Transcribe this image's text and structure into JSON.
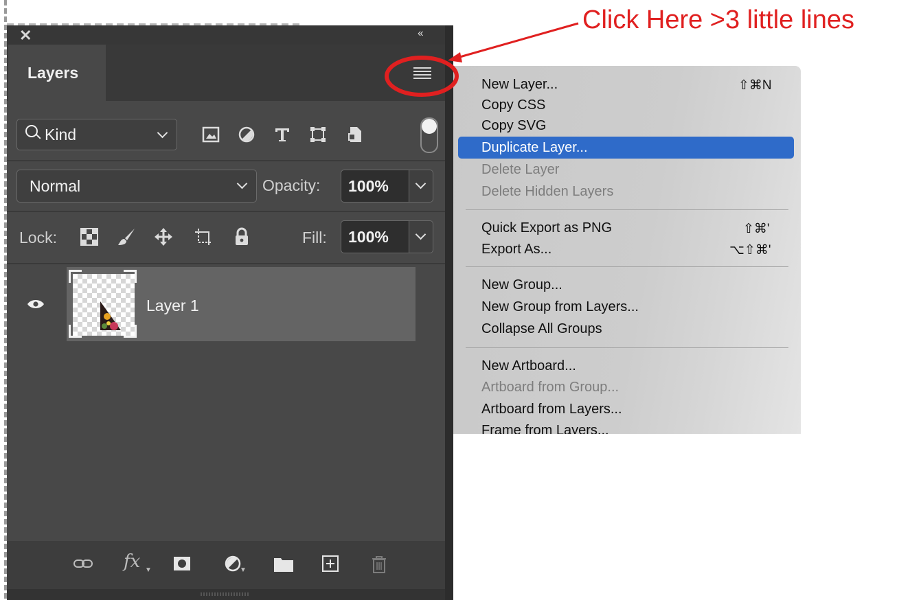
{
  "annotation": {
    "text": "Click Here >3 little lines",
    "color": "#e02020"
  },
  "panel": {
    "tab_label": "Layers",
    "kind_filter": "Kind",
    "filter_icons": [
      "image-filter-icon",
      "adjustment-filter-icon",
      "type-filter-icon",
      "shape-filter-icon",
      "smart-object-filter-icon"
    ],
    "blend_mode": "Normal",
    "opacity_label": "Opacity:",
    "opacity_value": "100%",
    "lock_label": "Lock:",
    "lock_icons": [
      "lock-transparent-pixels-icon",
      "lock-image-pixels-icon",
      "lock-position-icon",
      "lock-artboard-icon",
      "lock-all-icon"
    ],
    "fill_label": "Fill:",
    "fill_value": "100%",
    "layers": [
      {
        "name": "Layer 1",
        "visible": true
      }
    ],
    "footer_icons": [
      "link-layers-icon",
      "fx-icon",
      "layer-mask-icon",
      "adjustment-layer-icon",
      "group-folder-icon",
      "new-layer-icon",
      "trash-icon"
    ],
    "fx_text": "fx"
  },
  "menu": {
    "selected_color": "#2f6bc9",
    "items": [
      {
        "label": "New Layer...",
        "shortcut": "⇧⌘N",
        "state": "enabled"
      },
      {
        "label": "Copy CSS",
        "shortcut": "",
        "state": "enabled"
      },
      {
        "label": "Copy SVG",
        "shortcut": "",
        "state": "enabled"
      },
      {
        "label": "Duplicate Layer...",
        "shortcut": "",
        "state": "selected"
      },
      {
        "label": "Delete Layer",
        "shortcut": "",
        "state": "disabled"
      },
      {
        "label": "Delete Hidden Layers",
        "shortcut": "",
        "state": "disabled"
      },
      {
        "label": "Quick Export as PNG",
        "shortcut": "⇧⌘'",
        "state": "enabled"
      },
      {
        "label": "Export As...",
        "shortcut": "⌥⇧⌘'",
        "state": "enabled"
      },
      {
        "label": "New Group...",
        "shortcut": "",
        "state": "enabled"
      },
      {
        "label": "New Group from Layers...",
        "shortcut": "",
        "state": "enabled"
      },
      {
        "label": "Collapse All Groups",
        "shortcut": "",
        "state": "enabled"
      },
      {
        "label": "New Artboard...",
        "shortcut": "",
        "state": "enabled"
      },
      {
        "label": "Artboard from Group...",
        "shortcut": "",
        "state": "disabled"
      },
      {
        "label": "Artboard from Layers...",
        "shortcut": "",
        "state": "enabled"
      },
      {
        "label": "Frame from Layers...",
        "shortcut": "",
        "state": "enabled"
      }
    ]
  }
}
